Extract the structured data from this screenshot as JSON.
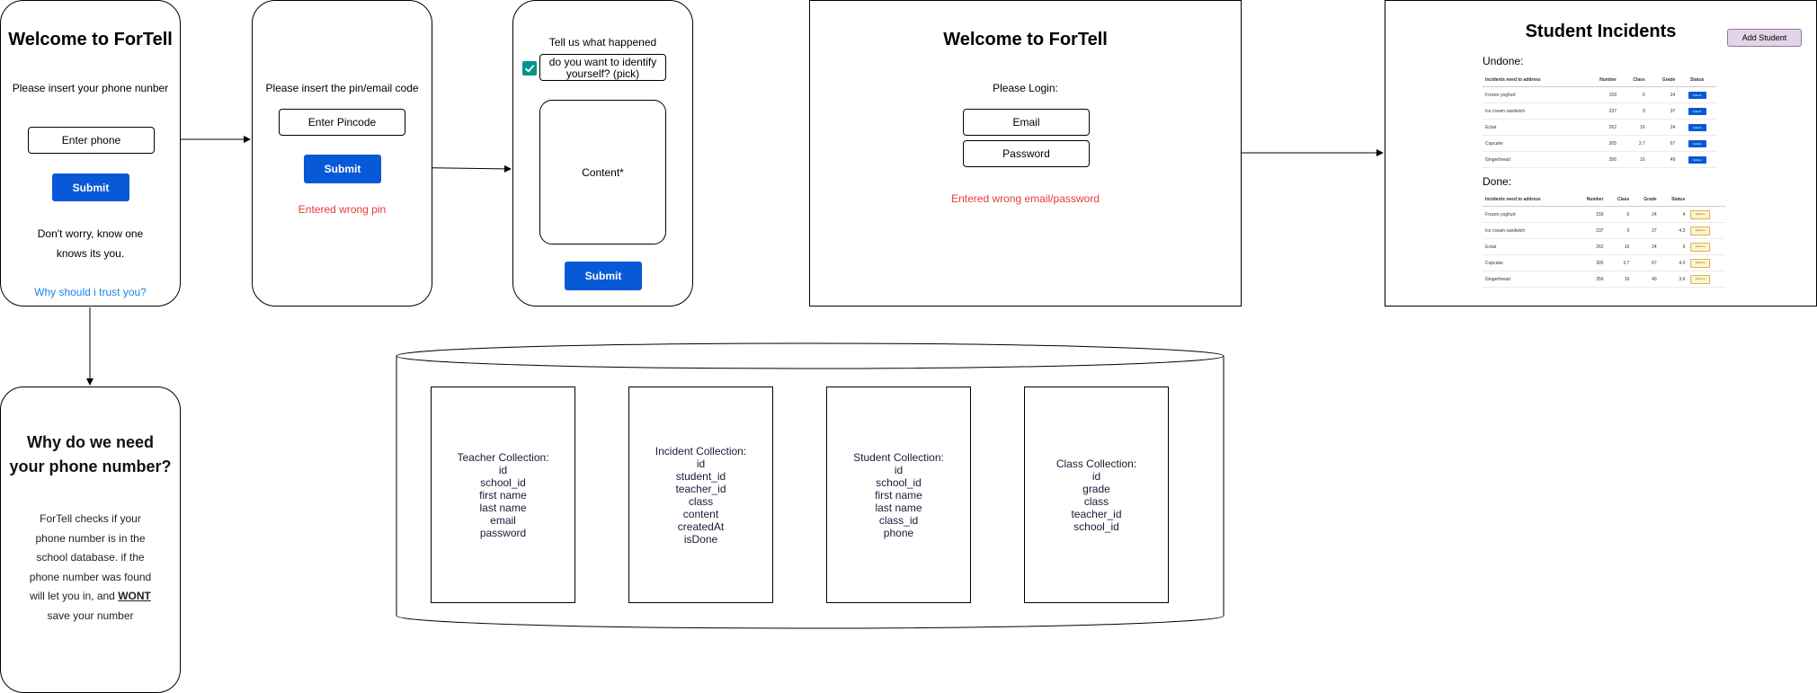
{
  "screen1": {
    "title": "Welcome to ForTell",
    "prompt": "Please insert your phone nunber",
    "input_placeholder": "Enter phone",
    "submit": "Submit",
    "reassure_line1": "Don't worry, know one",
    "reassure_line2": "knows its you.",
    "trust_link": "Why should i trust you?"
  },
  "screen2": {
    "prompt": "Please insert the pin/email code",
    "input_placeholder": "Enter Pincode",
    "submit": "Submit",
    "error": "Entered wrong pin"
  },
  "screen3": {
    "title": "Tell us what happened",
    "identify_line1": "do you want to identify",
    "identify_line2": "yourself? (pick)",
    "content": "Content*",
    "submit": "Submit"
  },
  "screen4": {
    "title_line1": "Why do we need",
    "title_line2": "your phone number?",
    "body_line1": "ForTell checks if your",
    "body_line2": "phone number is in the",
    "body_line3": "school database. if the",
    "body_line4": "phone number was found",
    "body_line5_pre": "will let you in, and ",
    "body_line5_strong": "WONT",
    "body_line6": "save your number"
  },
  "login": {
    "title": "Welcome to ForTell",
    "prompt": "Please Login:",
    "email": "Email",
    "password": "Password",
    "error": "Entered wrong email/password"
  },
  "incidents": {
    "title": "Student Incidents",
    "add_student": "Add Student",
    "undone_label": "Undone:",
    "done_label": "Done:",
    "headers": [
      "Incidents need to address",
      "Number",
      "Class",
      "Grade",
      "Status"
    ],
    "undone_rows": [
      [
        "Frozen yoghurt",
        "159",
        "6",
        "24",
        "Submit"
      ],
      [
        "Ice cream sandwich",
        "237",
        "9",
        "37",
        "Submit"
      ],
      [
        "Eclair",
        "262",
        "16",
        "24",
        "Submit"
      ],
      [
        "Cupcake",
        "305",
        "3.7",
        "67",
        "Submit"
      ],
      [
        "Gingerbread",
        "356",
        "16",
        "49",
        "Submit"
      ]
    ],
    "done_rows": [
      [
        "Frozen yoghurt",
        "159",
        "6",
        "24",
        "4",
        "Restore"
      ],
      [
        "Ice cream sandwich",
        "237",
        "9",
        "37",
        "4.3",
        "Restore"
      ],
      [
        "Eclair",
        "262",
        "16",
        "24",
        "6",
        "Restore"
      ],
      [
        "Cupcake",
        "305",
        "3.7",
        "67",
        "4.3",
        "Restore"
      ],
      [
        "Gingerbread",
        "356",
        "16",
        "49",
        "3.9",
        "Restore"
      ]
    ]
  },
  "collections": [
    {
      "title": "Teacher Collection:",
      "fields": [
        "id",
        "school_id",
        "first name",
        "last name",
        "email",
        "password"
      ]
    },
    {
      "title": "Incident Collection:",
      "fields": [
        "id",
        "student_id",
        "teacher_id",
        "class",
        "content",
        "createdAt",
        "isDone"
      ]
    },
    {
      "title": "Student Collection:",
      "fields": [
        "id",
        "school_id",
        "first name",
        "last name",
        "class_id",
        "phone"
      ]
    },
    {
      "title": "Class Collection:",
      "fields": [
        "id",
        "grade",
        "class",
        "teacher_id",
        "school_id"
      ]
    }
  ],
  "colors": {
    "primary": "#0759d7",
    "error": "#e53b3b",
    "link": "#1a85e6",
    "accent_purple": "#e1d5e7",
    "check": "#009688"
  }
}
